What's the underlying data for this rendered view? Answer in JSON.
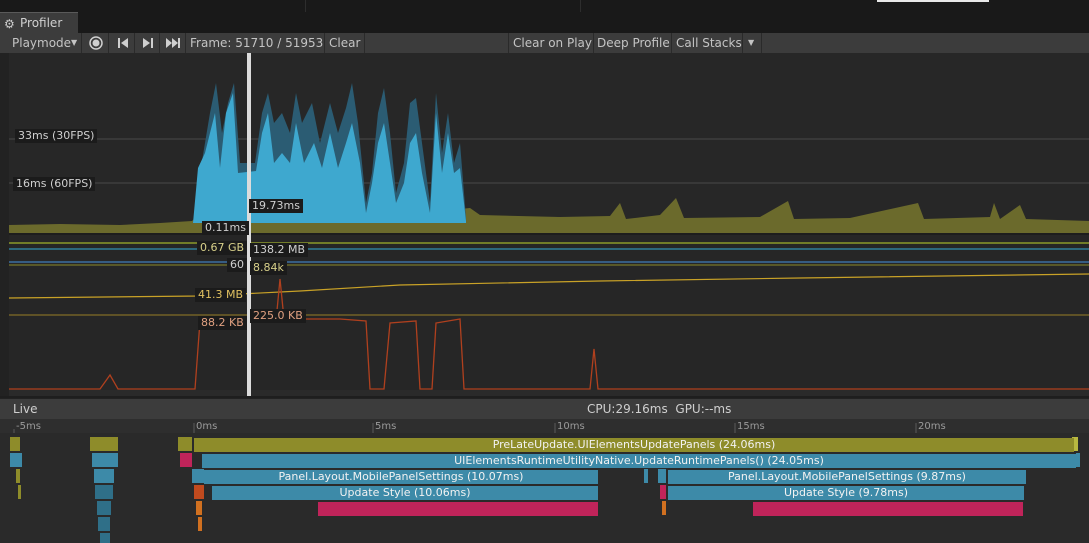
{
  "window": {
    "tab_title": "Profiler",
    "tab_icon": "profiler-gear-icon"
  },
  "toolbar": {
    "playmode": "Playmode",
    "frame_label": "Frame: 51710 / 51953",
    "clear": "Clear",
    "clear_on_play": "Clear on Play",
    "deep_profile": "Deep Profile",
    "call_stacks": "Call Stacks"
  },
  "chart": {
    "line_33": "33ms (30FPS)",
    "line_16": "16ms (60FPS)",
    "cpu_value": "19.73ms",
    "render_value": "0.11ms",
    "mem_total": "0.67 GB",
    "mem_mono": "138.2 MB",
    "fps_left": "60",
    "count_value": "8.84k",
    "gc_mem": "41.3 MB",
    "gc_alloc_left": "88.2 KB",
    "gc_alloc_right": "225.0 KB"
  },
  "live": {
    "label": "Live",
    "cpu": "CPU:29.16ms",
    "gpu": "GPU:--ms"
  },
  "timeline": {
    "ticks": [
      "-5ms",
      "0ms",
      "5ms",
      "10ms",
      "15ms",
      "20ms"
    ],
    "bars": {
      "prelate": "PreLateUpdate.UIElementsUpdatePanels (24.06ms)",
      "runtime": "UIElementsRuntimeUtilityNative.UpdateRuntimePanels() (24.05ms)",
      "layout1": "Panel.Layout.MobilePanelSettings (10.07ms)",
      "layout2": "Panel.Layout.MobilePanelSettings (9.87ms)",
      "style1": "Update Style (10.06ms)",
      "style2": "Update Style (9.78ms)"
    }
  },
  "colors": {
    "cpu_area": "#3ea8cf",
    "bg_area": "#6e6a2a",
    "bar_olive": "#8e8c2a",
    "bar_blue": "#3d8aa8",
    "bar_pink": "#c0245a",
    "gc_line": "#c04a1e",
    "mem_line": "#c9a227"
  }
}
